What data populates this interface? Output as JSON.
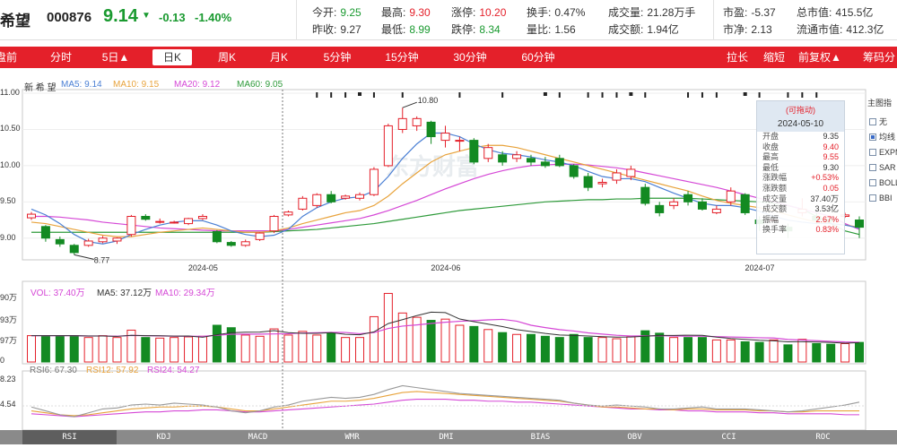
{
  "header": {
    "name": "希望",
    "code": "000876",
    "price": "9.14",
    "arrow": "▼",
    "change": "-0.13",
    "change_pct": "-1.40%",
    "quotes": [
      {
        "label": "今开:",
        "value": "9.25",
        "color": "green"
      },
      {
        "label": "最高:",
        "value": "9.30",
        "color": "red"
      },
      {
        "label": "涨停:",
        "value": "10.20",
        "color": "red"
      },
      {
        "label": "换手:",
        "value": "0.47%",
        "color": "dark"
      },
      {
        "label": "成交量:",
        "value": "21.28万手",
        "color": "dark"
      },
      {
        "label": "市盈:",
        "value": "-5.37",
        "color": "dark"
      },
      {
        "label": "总市值:",
        "value": "415.5亿",
        "color": "dark"
      },
      {
        "label": "昨收:",
        "value": "9.27",
        "color": "dark"
      },
      {
        "label": "最低:",
        "value": "8.99",
        "color": "green"
      },
      {
        "label": "跌停:",
        "value": "8.34",
        "color": "green"
      },
      {
        "label": "量比:",
        "value": "1.56",
        "color": "dark"
      },
      {
        "label": "成交额:",
        "value": "1.94亿",
        "color": "dark"
      },
      {
        "label": "市净:",
        "value": "2.13",
        "color": "dark"
      },
      {
        "label": "流通市值:",
        "value": "412.3亿",
        "color": "dark"
      }
    ]
  },
  "tabs": {
    "left": [
      "盘前",
      "分时",
      "5日▲",
      "日K",
      "周K",
      "月K",
      "5分钟",
      "15分钟",
      "30分钟",
      "60分钟"
    ],
    "right": [
      "拉长",
      "缩短",
      "前复权▲",
      "筹码分"
    ]
  },
  "main_chart": {
    "stock_label": "新 希 望",
    "ma_legend": [
      {
        "label": "MA5: 9.14",
        "color": "#4a7fd4"
      },
      {
        "label": "MA10: 9.15",
        "color": "#e8a33c"
      },
      {
        "label": "MA20: 9.12",
        "color": "#d548d6"
      },
      {
        "label": "MA60: 9.05",
        "color": "#2e9a3a"
      }
    ],
    "y_ticks": [
      "11.00",
      "10.50",
      "10.00",
      "9.50",
      "9.00"
    ],
    "x_ticks": [
      "2024-05",
      "2024-06",
      "2024-07"
    ],
    "high_marker": "10.80",
    "low_marker": "8.77",
    "watermark": "东方财富"
  },
  "tooltip": {
    "header": "(可拖动)",
    "date": "2024-05-10",
    "rows": [
      {
        "k": "开盘",
        "v": "9.35",
        "color": "dark"
      },
      {
        "k": "收盘",
        "v": "9.40",
        "color": "red"
      },
      {
        "k": "最高",
        "v": "9.55",
        "color": "red"
      },
      {
        "k": "最低",
        "v": "9.30",
        "color": "dark"
      },
      {
        "k": "涨跌幅",
        "v": "+0.53%",
        "color": "red"
      },
      {
        "k": "涨跌额",
        "v": "0.05",
        "color": "red"
      },
      {
        "k": "成交量",
        "v": "37.40万",
        "color": "dark"
      },
      {
        "k": "成交额",
        "v": "3.53亿",
        "color": "dark"
      },
      {
        "k": "振幅",
        "v": "2.67%",
        "color": "red"
      },
      {
        "k": "换手率",
        "v": "0.83%",
        "color": "red"
      }
    ]
  },
  "side_panel": {
    "title": "主图指",
    "options": [
      {
        "label": "无",
        "checked": false
      },
      {
        "label": "均线",
        "checked": true
      },
      {
        "label": "EXPM",
        "checked": false
      },
      {
        "label": "SAR",
        "checked": false
      },
      {
        "label": "BOLL",
        "checked": false
      },
      {
        "label": "BBI",
        "checked": false
      }
    ]
  },
  "volume": {
    "legend": [
      {
        "label": "VOL: 37.40万",
        "color": "#d548d6"
      },
      {
        "label": "MA5: 37.12万",
        "color": "#333333"
      },
      {
        "label": "MA10: 29.34万",
        "color": "#d548d6"
      }
    ],
    "y_ticks": [
      "90万",
      "93万",
      "97万",
      "0"
    ]
  },
  "rsi": {
    "legend": [
      {
        "label": "RSI6: 67.30",
        "color": "#777777"
      },
      {
        "label": "RSI12: 57.92",
        "color": "#e8a33c"
      },
      {
        "label": "RSI24: 54.27",
        "color": "#d548d6"
      }
    ],
    "y_ticks": [
      "8.23",
      "4.54"
    ]
  },
  "bottom_tabs": [
    "RSI",
    "KDJ",
    "MACD",
    "WMR",
    "DMI",
    "BIAS",
    "OBV",
    "CCI",
    "ROC"
  ],
  "colors": {
    "up": "#e4202a",
    "down": "#138a22",
    "accent": "#e4202a"
  },
  "chart_data": {
    "type": "candlestick",
    "ylim": [
      8.7,
      11.05
    ],
    "x_ticks": [
      "2024-05",
      "2024-06",
      "2024-07"
    ],
    "candles": [
      {
        "o": 9.28,
        "c": 9.33,
        "h": 9.36,
        "l": 9.25
      },
      {
        "o": 9.16,
        "c": 9.0,
        "h": 9.18,
        "l": 8.95
      },
      {
        "o": 8.98,
        "c": 8.92,
        "h": 9.02,
        "l": 8.88
      },
      {
        "o": 8.9,
        "c": 8.8,
        "h": 8.92,
        "l": 8.77
      },
      {
        "o": 8.9,
        "c": 8.96,
        "h": 8.99,
        "l": 8.88
      },
      {
        "o": 8.95,
        "c": 9.0,
        "h": 9.03,
        "l": 8.93
      },
      {
        "o": 8.96,
        "c": 9.0,
        "h": 9.01,
        "l": 8.92
      },
      {
        "o": 9.05,
        "c": 9.3,
        "h": 9.32,
        "l": 9.02
      },
      {
        "o": 9.3,
        "c": 9.26,
        "h": 9.33,
        "l": 9.24
      },
      {
        "o": 9.22,
        "c": 9.23,
        "h": 9.27,
        "l": 9.2
      },
      {
        "o": 9.22,
        "c": 9.22,
        "h": 9.24,
        "l": 9.2
      },
      {
        "o": 9.2,
        "c": 9.27,
        "h": 9.28,
        "l": 9.18
      },
      {
        "o": 9.27,
        "c": 9.3,
        "h": 9.33,
        "l": 9.25
      },
      {
        "o": 9.09,
        "c": 8.95,
        "h": 9.11,
        "l": 8.93
      },
      {
        "o": 8.94,
        "c": 8.9,
        "h": 8.96,
        "l": 8.88
      },
      {
        "o": 8.9,
        "c": 8.95,
        "h": 8.98,
        "l": 8.88
      },
      {
        "o": 8.98,
        "c": 9.07,
        "h": 9.08,
        "l": 8.96
      },
      {
        "o": 9.1,
        "c": 9.3,
        "h": 9.32,
        "l": 9.07
      },
      {
        "o": 9.32,
        "c": 9.36,
        "h": 9.38,
        "l": 9.3
      },
      {
        "o": 9.4,
        "c": 9.55,
        "h": 9.58,
        "l": 9.38
      },
      {
        "o": 9.45,
        "c": 9.6,
        "h": 9.62,
        "l": 9.42
      },
      {
        "o": 9.6,
        "c": 9.5,
        "h": 9.65,
        "l": 9.48
      },
      {
        "o": 9.55,
        "c": 9.58,
        "h": 9.6,
        "l": 9.53
      },
      {
        "o": 9.55,
        "c": 9.6,
        "h": 9.63,
        "l": 9.52
      },
      {
        "o": 9.6,
        "c": 9.95,
        "h": 9.98,
        "l": 9.58
      },
      {
        "o": 10.0,
        "c": 10.55,
        "h": 10.58,
        "l": 9.98
      },
      {
        "o": 10.5,
        "c": 10.65,
        "h": 10.8,
        "l": 10.45
      },
      {
        "o": 10.55,
        "c": 10.65,
        "h": 10.68,
        "l": 10.48
      },
      {
        "o": 10.6,
        "c": 10.4,
        "h": 10.62,
        "l": 10.3
      },
      {
        "o": 10.35,
        "c": 10.45,
        "h": 10.55,
        "l": 10.25
      },
      {
        "o": 10.35,
        "c": 10.35,
        "h": 10.4,
        "l": 10.2
      },
      {
        "o": 10.35,
        "c": 10.05,
        "h": 10.38,
        "l": 10.02
      },
      {
        "o": 10.1,
        "c": 10.25,
        "h": 10.3,
        "l": 10.05
      },
      {
        "o": 10.15,
        "c": 10.05,
        "h": 10.2,
        "l": 10.0
      },
      {
        "o": 10.1,
        "c": 10.15,
        "h": 10.2,
        "l": 10.05
      },
      {
        "o": 10.1,
        "c": 10.05,
        "h": 10.15,
        "l": 10.0
      },
      {
        "o": 10.05,
        "c": 10.0,
        "h": 10.12,
        "l": 9.97
      },
      {
        "o": 10.1,
        "c": 10.0,
        "h": 10.15,
        "l": 9.98
      },
      {
        "o": 10.0,
        "c": 9.85,
        "h": 10.02,
        "l": 9.82
      },
      {
        "o": 9.85,
        "c": 9.7,
        "h": 9.9,
        "l": 9.65
      },
      {
        "o": 9.75,
        "c": 9.77,
        "h": 9.82,
        "l": 9.7
      },
      {
        "o": 9.8,
        "c": 9.9,
        "h": 9.95,
        "l": 9.75
      },
      {
        "o": 9.85,
        "c": 9.95,
        "h": 10.0,
        "l": 9.8
      },
      {
        "o": 9.7,
        "c": 9.48,
        "h": 9.75,
        "l": 9.45
      },
      {
        "o": 9.45,
        "c": 9.35,
        "h": 9.5,
        "l": 9.3
      },
      {
        "o": 9.45,
        "c": 9.5,
        "h": 9.55,
        "l": 9.4
      },
      {
        "o": 9.6,
        "c": 9.5,
        "h": 9.65,
        "l": 9.45
      },
      {
        "o": 9.5,
        "c": 9.4,
        "h": 9.55,
        "l": 9.38
      },
      {
        "o": 9.35,
        "c": 9.4,
        "h": 9.45,
        "l": 9.33
      },
      {
        "o": 9.5,
        "c": 9.65,
        "h": 9.7,
        "l": 9.45
      },
      {
        "o": 9.6,
        "c": 9.35,
        "h": 9.62,
        "l": 9.32
      },
      {
        "o": 9.25,
        "c": 9.2,
        "h": 9.3,
        "l": 9.1
      },
      {
        "o": 9.25,
        "c": 9.25,
        "h": 9.27,
        "l": 9.23
      },
      {
        "o": 9.15,
        "c": 9.1,
        "h": 9.2,
        "l": 9.0
      },
      {
        "o": 9.35,
        "c": 9.4,
        "h": 9.55,
        "l": 9.3
      },
      {
        "o": 9.3,
        "c": 9.25,
        "h": 9.35,
        "l": 9.2
      },
      {
        "o": 9.26,
        "c": 9.24,
        "h": 9.3,
        "l": 9.2
      },
      {
        "o": 9.3,
        "c": 9.32,
        "h": 9.35,
        "l": 9.28
      },
      {
        "o": 9.25,
        "c": 9.15,
        "h": 9.3,
        "l": 9.0
      }
    ],
    "volume": [
      43,
      43,
      43,
      43,
      40,
      43,
      40,
      52,
      40,
      39,
      40,
      41,
      42,
      60,
      56,
      44,
      42,
      54,
      44,
      50,
      44,
      48,
      40,
      40,
      74,
      112,
      80,
      73,
      68,
      70,
      60,
      58,
      53,
      48,
      45,
      45,
      42,
      40,
      45,
      40,
      40,
      38,
      41,
      51,
      47,
      40,
      40,
      40,
      36,
      36,
      33,
      32,
      36,
      28,
      37,
      30,
      29,
      30,
      32
    ],
    "ma5": [
      9.4,
      9.32,
      9.2,
      9.05,
      8.95,
      8.92,
      8.96,
      9.05,
      9.12,
      9.18,
      9.22,
      9.24,
      9.24,
      9.18,
      9.1,
      9.05,
      9.02,
      9.04,
      9.12,
      9.3,
      9.42,
      9.5,
      9.55,
      9.57,
      9.65,
      9.85,
      10.1,
      10.3,
      10.45,
      10.45,
      10.4,
      10.3,
      10.22,
      10.17,
      10.15,
      10.12,
      10.08,
      10.05,
      10.0,
      9.92,
      9.85,
      9.82,
      9.82,
      9.78,
      9.7,
      9.62,
      9.55,
      9.48,
      9.45,
      9.45,
      9.42,
      9.37,
      9.3,
      9.25,
      9.22,
      9.2,
      9.2,
      9.18,
      9.14
    ],
    "ma10": [
      9.22,
      9.2,
      9.16,
      9.12,
      9.08,
      9.04,
      9.02,
      9.02,
      9.05,
      9.08,
      9.1,
      9.12,
      9.14,
      9.12,
      9.1,
      9.08,
      9.08,
      9.1,
      9.14,
      9.2,
      9.25,
      9.3,
      9.35,
      9.38,
      9.45,
      9.58,
      9.75,
      9.9,
      10.05,
      10.15,
      10.2,
      10.25,
      10.28,
      10.28,
      10.25,
      10.2,
      10.15,
      10.1,
      10.05,
      10.0,
      9.95,
      9.9,
      9.85,
      9.8,
      9.75,
      9.7,
      9.65,
      9.58,
      9.52,
      9.48,
      9.45,
      9.42,
      9.38,
      9.32,
      9.27,
      9.22,
      9.2,
      9.18,
      9.15
    ],
    "ma20": [
      9.3,
      9.3,
      9.29,
      9.27,
      9.25,
      9.22,
      9.2,
      9.18,
      9.16,
      9.14,
      9.13,
      9.12,
      9.11,
      9.1,
      9.1,
      9.1,
      9.1,
      9.1,
      9.12,
      9.15,
      9.18,
      9.21,
      9.24,
      9.27,
      9.32,
      9.38,
      9.45,
      9.52,
      9.6,
      9.68,
      9.75,
      9.82,
      9.88,
      9.93,
      9.97,
      10.0,
      10.01,
      10.02,
      10.02,
      10.01,
      9.99,
      9.97,
      9.94,
      9.9,
      9.86,
      9.82,
      9.78,
      9.74,
      9.7,
      9.65,
      9.6,
      9.55,
      9.5,
      9.45,
      9.4,
      9.35,
      9.3,
      9.2,
      9.12
    ],
    "ma60": [
      9.08,
      9.08,
      9.08,
      9.08,
      9.08,
      9.08,
      9.08,
      9.08,
      9.08,
      9.08,
      9.08,
      9.08,
      9.08,
      9.08,
      9.08,
      9.08,
      9.08,
      9.09,
      9.1,
      9.11,
      9.12,
      9.14,
      9.16,
      9.18,
      9.2,
      9.23,
      9.26,
      9.29,
      9.32,
      9.35,
      9.38,
      9.4,
      9.42,
      9.44,
      9.46,
      9.48,
      9.5,
      9.51,
      9.52,
      9.53,
      9.53,
      9.54,
      9.54,
      9.55,
      9.55,
      9.55,
      9.55,
      9.54,
      9.53,
      9.52,
      9.51,
      9.5,
      9.48,
      9.45,
      9.4,
      9.3,
      9.2,
      9.1,
      9.05
    ],
    "rsi6": [
      62,
      58,
      54,
      52,
      56,
      60,
      61,
      64,
      65,
      64,
      66,
      65,
      64,
      62,
      58,
      56,
      58,
      62,
      64,
      68,
      70,
      72,
      71,
      72,
      75,
      80,
      84,
      82,
      80,
      78,
      76,
      75,
      74,
      73,
      72,
      71,
      70,
      69,
      66,
      64,
      63,
      64,
      63,
      62,
      60,
      60,
      61,
      62,
      60,
      60,
      60,
      59,
      58,
      57,
      58,
      60,
      62,
      64,
      67
    ],
    "rsi12": [
      58,
      56,
      54,
      53,
      54,
      56,
      58,
      60,
      61,
      62,
      62,
      63,
      63,
      62,
      60,
      58,
      58,
      60,
      62,
      64,
      66,
      68,
      68,
      69,
      71,
      74,
      77,
      78,
      77,
      76,
      75,
      74,
      73,
      72,
      71,
      70,
      69,
      68,
      66,
      64,
      62,
      62,
      61,
      60,
      60,
      59,
      60,
      60,
      59,
      59,
      59,
      58,
      58,
      57,
      57,
      58,
      58,
      58,
      58
    ],
    "rsi24": [
      55,
      54,
      53,
      52,
      53,
      54,
      55,
      56,
      57,
      57,
      58,
      58,
      59,
      59,
      58,
      57,
      57,
      58,
      59,
      60,
      61,
      62,
      63,
      64,
      65,
      67,
      69,
      70,
      70,
      70,
      69,
      69,
      68,
      68,
      67,
      67,
      66,
      65,
      64,
      63,
      62,
      61,
      60,
      60,
      59,
      59,
      58,
      58,
      57,
      57,
      57,
      56,
      56,
      55,
      55,
      55,
      55,
      54,
      54
    ]
  }
}
